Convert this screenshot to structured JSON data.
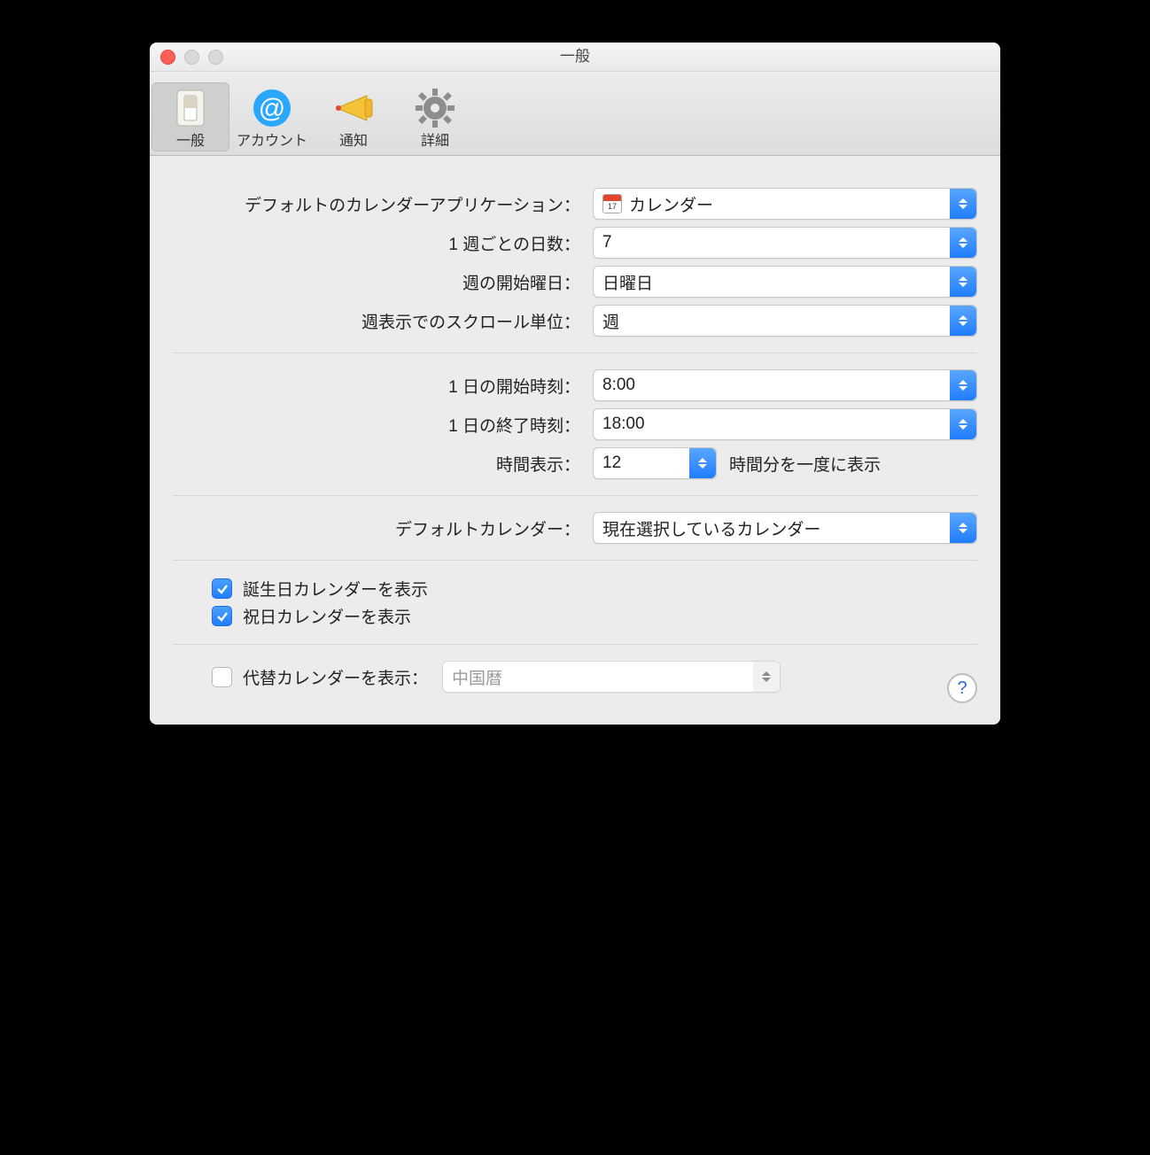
{
  "window": {
    "title": "一般"
  },
  "toolbar": {
    "general": "一般",
    "accounts": "アカウント",
    "alerts": "通知",
    "advanced": "詳細"
  },
  "labels": {
    "default_app": "デフォルトのカレンダーアプリケーション：",
    "days_per_week": "1 週ごとの日数：",
    "start_weekday": "週の開始曜日：",
    "scroll_unit": "週表示でのスクロール単位：",
    "day_start": "1 日の開始時刻：",
    "day_end": "1 日の終了時刻：",
    "hours_show": "時間表示：",
    "hours_suffix": "時間分を一度に表示",
    "default_cal": "デフォルトカレンダー：",
    "show_birthday": "誕生日カレンダーを表示",
    "show_holiday": "祝日カレンダーを表示",
    "alt_calendar": "代替カレンダーを表示：",
    "help": "?"
  },
  "values": {
    "default_app": "カレンダー",
    "days_per_week": "7",
    "start_weekday": "日曜日",
    "scroll_unit": "週",
    "day_start": "8:00",
    "day_end": "18:00",
    "hours_show": "12",
    "default_cal": "現在選択しているカレンダー",
    "alt_calendar": "中国暦"
  },
  "state": {
    "show_birthday_checked": true,
    "show_holiday_checked": true,
    "alt_calendar_checked": false,
    "alt_calendar_enabled": false
  }
}
